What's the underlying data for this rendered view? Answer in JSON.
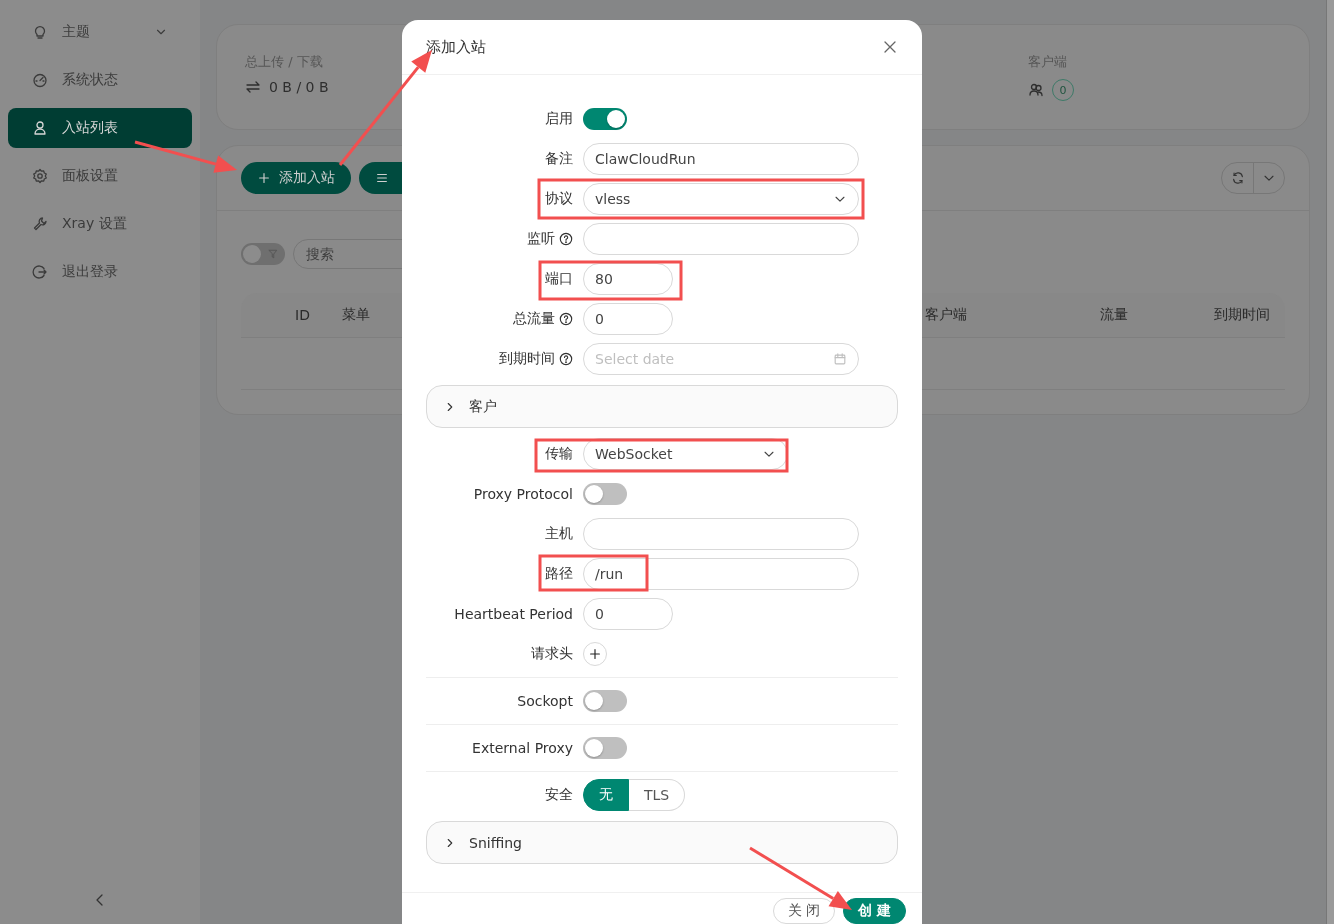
{
  "sidebar": {
    "items": [
      {
        "label": "主题",
        "selected": false,
        "expanded": false
      },
      {
        "label": "系统状态",
        "selected": false
      },
      {
        "label": "入站列表",
        "selected": true
      },
      {
        "label": "面板设置",
        "selected": false
      },
      {
        "label": "Xray 设置",
        "selected": false
      },
      {
        "label": "退出登录",
        "selected": false
      }
    ]
  },
  "stats": [
    {
      "label": "总上传 / 下载",
      "value": "0 B / 0 B",
      "kind": "traffic"
    },
    {
      "label": "客户端",
      "value": "0",
      "kind": "clients"
    }
  ],
  "toolbar": {
    "add_button": "添加入站"
  },
  "filter": {
    "on": false,
    "search_placeholder": "搜索"
  },
  "table": {
    "columns": [
      "ID",
      "菜单",
      "客户端",
      "流量",
      "到期时间"
    ]
  },
  "dialog": {
    "title": "添加入站",
    "fields": [
      {
        "kind": "switch",
        "label": "启用",
        "on": true
      },
      {
        "kind": "input",
        "label": "备注",
        "value": "ClawCloudRun"
      },
      {
        "kind": "select",
        "label": "协议",
        "value": "vless"
      },
      {
        "kind": "input",
        "label": "监听",
        "help": true
      },
      {
        "kind": "number",
        "label": "端口",
        "value": "80"
      },
      {
        "kind": "number",
        "label": "总流量",
        "help": true,
        "value": "0"
      },
      {
        "kind": "date",
        "label": "到期时间",
        "help": true,
        "placeholder": "Select date"
      },
      {
        "kind": "collapse",
        "title": "客户",
        "expanded": false
      },
      {
        "kind": "select",
        "label": "传输",
        "value": "WebSocket"
      },
      {
        "kind": "switch",
        "label": "Proxy Protocol",
        "on": false
      },
      {
        "kind": "input",
        "label": "主机"
      },
      {
        "kind": "input",
        "label": "路径",
        "value": "/run"
      },
      {
        "kind": "number",
        "label": "Heartbeat Period",
        "value": "0"
      },
      {
        "kind": "add",
        "label": "请求头"
      },
      {
        "kind": "divider"
      },
      {
        "kind": "switch",
        "label": "Sockopt",
        "on": false
      },
      {
        "kind": "divider"
      },
      {
        "kind": "switch",
        "label": "External Proxy",
        "on": false
      },
      {
        "kind": "divider"
      },
      {
        "kind": "radio",
        "label": "安全",
        "options": [
          {
            "label": "无",
            "selected": true
          },
          {
            "label": "TLS",
            "selected": false
          }
        ]
      },
      {
        "kind": "collapse",
        "title": "Sniffing",
        "expanded": false
      }
    ],
    "buttons": [
      {
        "label": "关 闭",
        "kind": "default"
      },
      {
        "label": "创 建",
        "kind": "primary"
      }
    ]
  }
}
